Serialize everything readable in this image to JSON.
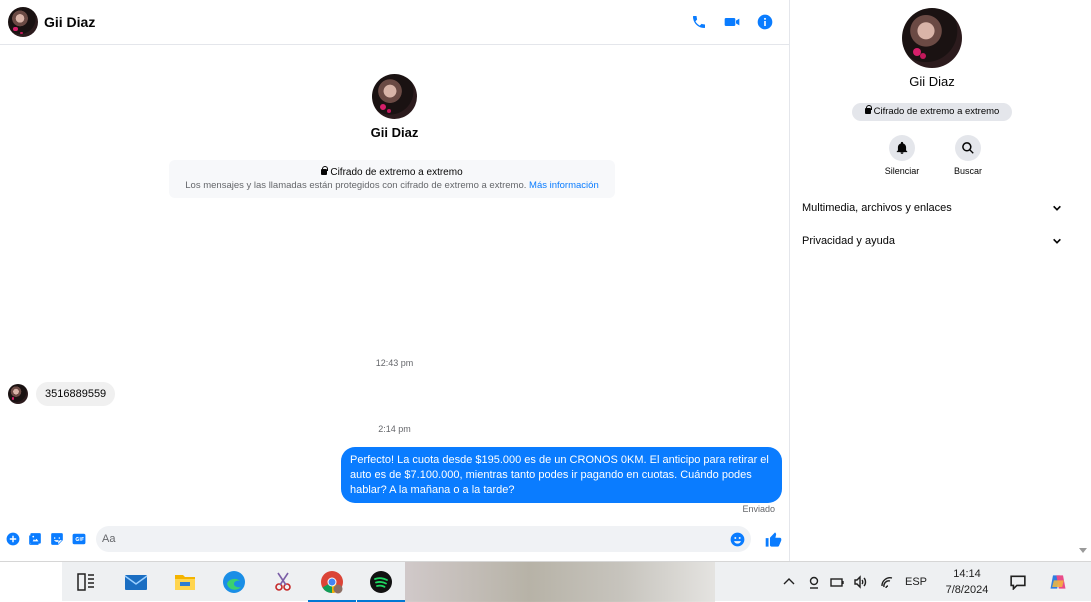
{
  "contact": {
    "name": "Gii Diaz"
  },
  "header": {
    "icons": [
      "phone-icon",
      "video-camera-icon",
      "info-icon"
    ]
  },
  "encryption": {
    "title": "Cifrado de extremo a extremo",
    "description": "Los mensajes y las llamadas están protegidos con cifrado de extremo a extremo.",
    "link": "Más información"
  },
  "messages": [
    {
      "timestamp": "12:43 pm",
      "direction": "incoming",
      "text": "3516889559"
    },
    {
      "timestamp": "2:14 pm",
      "direction": "outgoing",
      "text": "Perfecto! La cuota desde $195.000 es de un CRONOS 0KM. El anticipo para retirar el auto es de $7.100.000, mientras tanto podes ir pagando en cuotas. Cuándo podes hablar? A la mañana o a la tarde?",
      "status": "Enviado"
    }
  ],
  "composer": {
    "placeholder": "Aa",
    "icons": [
      "plus-icon",
      "image-icon",
      "sticker-icon",
      "gif-icon",
      "emoji-icon",
      "thumbs-up-icon"
    ]
  },
  "info_panel": {
    "name": "Gii Diaz",
    "badge": "Cifrado de extremo a extremo",
    "actions": [
      {
        "label": "Silenciar",
        "icon": "bell-icon"
      },
      {
        "label": "Buscar",
        "icon": "search-icon"
      }
    ],
    "sections": [
      "Multimedia, archivos y enlaces",
      "Privacidad y ayuda"
    ]
  },
  "taskbar": {
    "apps": [
      "task-view-icon",
      "mail-icon",
      "file-explorer-icon",
      "edge-icon",
      "snipping-tool-icon",
      "chrome-icon",
      "spotify-icon"
    ],
    "language": "ESP",
    "time": "14:14",
    "date": "7/8/2024"
  },
  "colors": {
    "accent": "#0a7cff",
    "bubble_in": "#f0f0f0",
    "text_secondary": "#65676b"
  }
}
